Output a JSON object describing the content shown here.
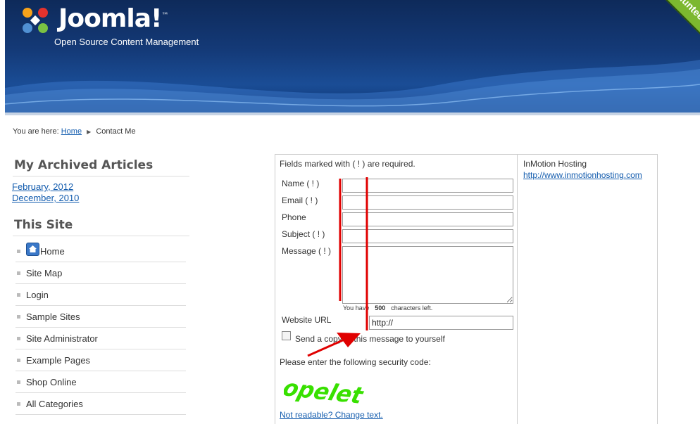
{
  "header": {
    "logo_text": "Joomla!",
    "logo_tm": "™",
    "tagline": "Open Source Content Management",
    "corner_ribbon": "Volunteer",
    "colors": {
      "background": "#143a78",
      "ribbon": "#7cb82f"
    }
  },
  "breadcrumb": {
    "prefix": "You are here:",
    "home": "Home",
    "separator_icon": "triangle-right-icon",
    "current": "Contact Me"
  },
  "archive": {
    "title": "My Archived Articles",
    "items": [
      "February, 2012",
      "December, 2010"
    ]
  },
  "site_menu": {
    "title": "This Site",
    "items": [
      "Home",
      "Site Map",
      "Login",
      "Sample Sites",
      "Site Administrator",
      "Example Pages",
      "Shop Online",
      "All Categories"
    ]
  },
  "contact_form": {
    "required_note": "Fields marked with ( ! ) are required.",
    "name_label": "Name  ( ! )",
    "email_label": "Email  ( ! )",
    "phone_label": "Phone",
    "subject_label": "Subject  ( ! )",
    "message_label": "Message  ( ! )",
    "chars_prefix": "You have",
    "chars_count": "500",
    "chars_suffix": "characters left.",
    "website_label": "Website URL",
    "website_value": "http://",
    "copy_label": "Send a copy of this message to yourself",
    "security_note": "Please enter the following security code:",
    "captcha_code": "opelet",
    "change_text": "Not readable? Change text."
  },
  "sponsor": {
    "name": "InMotion Hosting",
    "link": "http://www.inmotionhosting.com"
  },
  "annotation_color": "#e00000"
}
